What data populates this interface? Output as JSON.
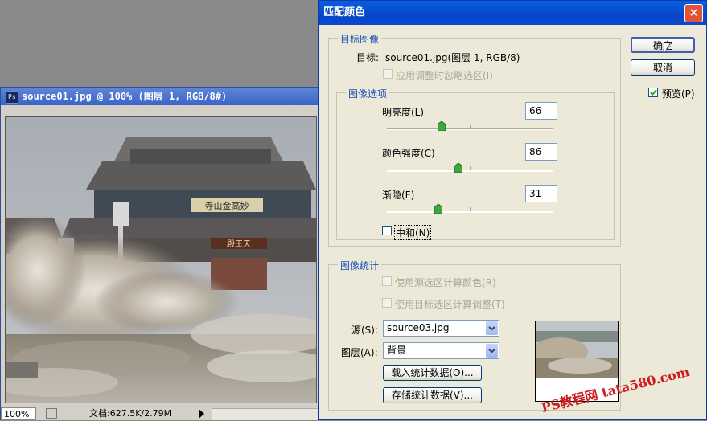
{
  "document": {
    "title": "source01.jpg @ 100% (图层 1, RGB/8#)",
    "ps_badge": "Ps",
    "zoom": "100%",
    "doc_info": "文档:627.5K/2.79M",
    "sign_text": "寺山金高妙",
    "gate_text": "殿王天"
  },
  "dialog": {
    "title": "匹配颜色",
    "close": "×",
    "ok_label": "确定",
    "cancel_label": "取消",
    "preview_label": "预览(P)",
    "preview_checked": true,
    "target": {
      "group_label": "目标图像",
      "target_label": "目标:",
      "target_value": "source01.jpg(图层 1, RGB/8)",
      "ignore_selection_label": "应用调整时忽略选区(I)"
    },
    "image_options": {
      "group_label": "图像选项",
      "luminance_label": "明亮度(L)",
      "luminance_value": "66",
      "luminance_level": 0.33,
      "color_intensity_label": "颜色强度(C)",
      "color_intensity_value": "86",
      "color_intensity_level": 0.43,
      "fade_label": "渐隐(F)",
      "fade_value": "31",
      "fade_level": 0.31,
      "neutralize_label": "中和(N)"
    },
    "image_stats": {
      "group_label": "图像统计",
      "use_source_selection_label": "使用源选区计算颜色(R)",
      "use_target_selection_label": "使用目标选区计算调整(T)",
      "source_label": "源(S):",
      "source_value": "source03.jpg",
      "layer_label": "图层(A):",
      "layer_value": "背景",
      "load_stats_label": "载入统计数据(O)...",
      "save_stats_label": "存储统计数据(V)..."
    }
  },
  "watermark": "PS教程网 tata580.com"
}
